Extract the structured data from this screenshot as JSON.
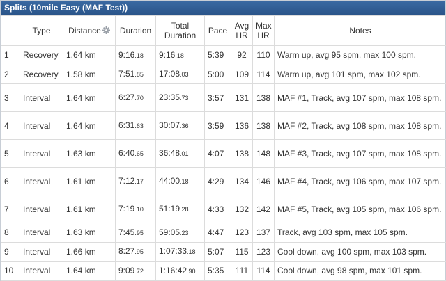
{
  "panel": {
    "title": "Splits (10mile Easy (MAF Test))"
  },
  "columns": {
    "num": "",
    "type": "Type",
    "distance": "Distance",
    "duration": "Duration",
    "total_line1": "Total",
    "total_line2": "Duration",
    "pace": "Pace",
    "avg_line1": "Avg",
    "avg_line2": "HR",
    "max_line1": "Max",
    "max_line2": "HR",
    "notes": "Notes"
  },
  "icons": {
    "distance_settings": "gear-icon"
  },
  "colors": {
    "title_bg": "#2f5d96",
    "title_text": "#ffffff",
    "grid": "#dcdcdc"
  },
  "rows": [
    {
      "num": "1",
      "type": "Recovery",
      "distance": "1.64 km",
      "duration_main": "9:16",
      "duration_cs": ".18",
      "total_main": "9:16",
      "total_cs": ".18",
      "pace": "5:39",
      "avg_hr": "92",
      "max_hr": "110",
      "notes": "Warm up, avg 95 spm, max 100 spm."
    },
    {
      "num": "2",
      "type": "Recovery",
      "distance": "1.58 km",
      "duration_main": "7:51",
      "duration_cs": ".85",
      "total_main": "17:08",
      "total_cs": ".03",
      "pace": "5:00",
      "avg_hr": "109",
      "max_hr": "114",
      "notes": "Warm up, avg 101 spm, max 102 spm."
    },
    {
      "num": "3",
      "type": "Interval",
      "distance": "1.64 km",
      "duration_main": "6:27",
      "duration_cs": ".70",
      "total_main": "23:35",
      "total_cs": ".73",
      "pace": "3:57",
      "avg_hr": "131",
      "max_hr": "138",
      "notes": "MAF #1, Track, avg 107 spm, max 108 spm."
    },
    {
      "num": "4",
      "type": "Interval",
      "distance": "1.64 km",
      "duration_main": "6:31",
      "duration_cs": ".63",
      "total_main": "30:07",
      "total_cs": ".36",
      "pace": "3:59",
      "avg_hr": "136",
      "max_hr": "138",
      "notes": "MAF #2, Track, avg 108 spm, max 108 spm."
    },
    {
      "num": "5",
      "type": "Interval",
      "distance": "1.63 km",
      "duration_main": "6:40",
      "duration_cs": ".65",
      "total_main": "36:48",
      "total_cs": ".01",
      "pace": "4:07",
      "avg_hr": "138",
      "max_hr": "148",
      "notes": "MAF #3, Track, avg 107 spm, max 108 spm."
    },
    {
      "num": "6",
      "type": "Interval",
      "distance": "1.61 km",
      "duration_main": "7:12",
      "duration_cs": ".17",
      "total_main": "44:00",
      "total_cs": ".18",
      "pace": "4:29",
      "avg_hr": "134",
      "max_hr": "146",
      "notes": "MAF #4, Track, avg 106 spm, max 107 spm."
    },
    {
      "num": "7",
      "type": "Interval",
      "distance": "1.61 km",
      "duration_main": "7:19",
      "duration_cs": ".10",
      "total_main": "51:19",
      "total_cs": ".28",
      "pace": "4:33",
      "avg_hr": "132",
      "max_hr": "142",
      "notes": "MAF #5, Track, avg 105 spm, max 106 spm."
    },
    {
      "num": "8",
      "type": "Interval",
      "distance": "1.63 km",
      "duration_main": "7:45",
      "duration_cs": ".95",
      "total_main": "59:05",
      "total_cs": ".23",
      "pace": "4:47",
      "avg_hr": "123",
      "max_hr": "137",
      "notes": "Track, avg 103 spm, max 105 spm."
    },
    {
      "num": "9",
      "type": "Interval",
      "distance": "1.66 km",
      "duration_main": "8:27",
      "duration_cs": ".95",
      "total_main": "1:07:33",
      "total_cs": ".18",
      "pace": "5:07",
      "avg_hr": "115",
      "max_hr": "123",
      "notes": "Cool down, avg 100 spm, max 103 spm."
    },
    {
      "num": "10",
      "type": "Interval",
      "distance": "1.64 km",
      "duration_main": "9:09",
      "duration_cs": ".72",
      "total_main": "1:16:42",
      "total_cs": ".90",
      "pace": "5:35",
      "avg_hr": "111",
      "max_hr": "114",
      "notes": "Cool down, avg 98 spm, max 101 spm."
    }
  ]
}
